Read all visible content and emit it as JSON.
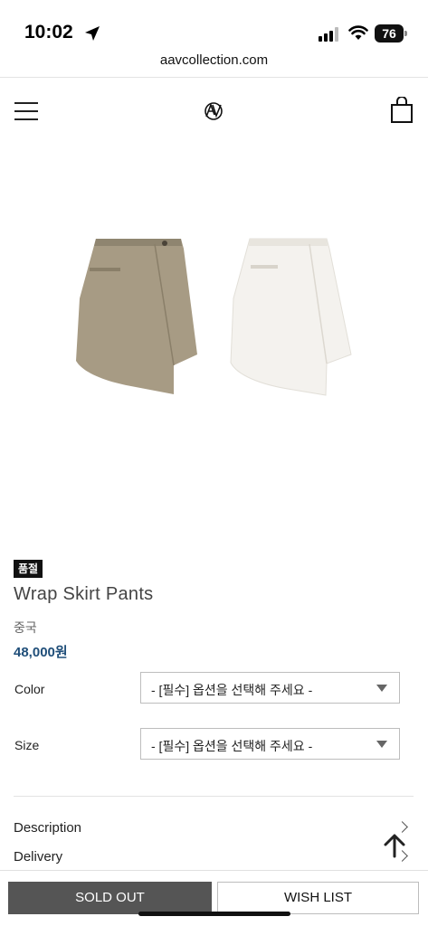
{
  "status_bar": {
    "time": "10:02",
    "battery": "76"
  },
  "browser": {
    "url": "aavcollection.com"
  },
  "header": {
    "logo_icon": "aav-logo-icon",
    "menu_icon": "hamburger-icon",
    "cart_icon": "shopping-bag-icon"
  },
  "product": {
    "badge": "품절",
    "name": "Wrap Skirt Pants",
    "origin": "중국",
    "price": "48,000원",
    "image_colors": {
      "skirt_1": "#a79b84",
      "skirt_2": "#f4f2ee"
    }
  },
  "options": [
    {
      "label": "Color",
      "value": "- [필수] 옵션을 선택해 주세요 -"
    },
    {
      "label": "Size",
      "value": "- [필수] 옵션을 선택해 주세요 -"
    }
  ],
  "info_links": [
    {
      "label": "Description"
    },
    {
      "label": "Delivery"
    }
  ],
  "actions": {
    "sold_out": "SOLD OUT",
    "wish_list": "WISH LIST"
  },
  "colors": {
    "price": "#1f4e79",
    "sold_out_bg": "#555555"
  }
}
